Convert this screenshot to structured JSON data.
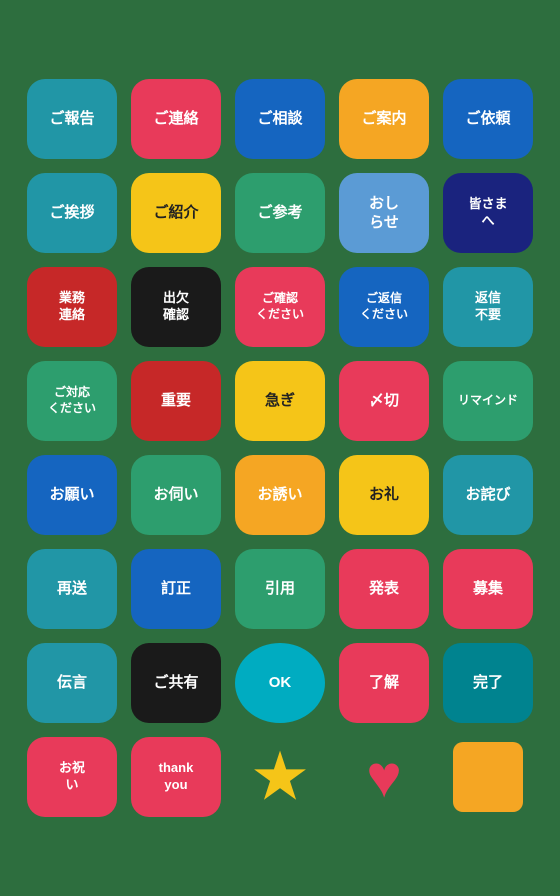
{
  "badges": [
    {
      "id": "gohoukoku",
      "label": "ご報告",
      "bg": "#2196a6",
      "textSize": "normal"
    },
    {
      "id": "gorenraku",
      "label": "ご連絡",
      "bg": "#e83a5a",
      "textSize": "normal"
    },
    {
      "id": "gosoudan",
      "label": "ご相談",
      "bg": "#1565c0",
      "textSize": "normal"
    },
    {
      "id": "goannai",
      "label": "ご案内",
      "bg": "#f5a623",
      "textSize": "normal"
    },
    {
      "id": "goirai",
      "label": "ご依頼",
      "bg": "#1565c0",
      "textSize": "normal"
    },
    {
      "id": "goaisatsu",
      "label": "ご挨拶",
      "bg": "#2196a6",
      "textSize": "normal"
    },
    {
      "id": "goshoukai",
      "label": "ご紹介",
      "bg": "#f5c518",
      "textSize": "normal",
      "textColor": "#222"
    },
    {
      "id": "gosankou",
      "label": "ご参考",
      "bg": "#2d9e6e",
      "textSize": "normal"
    },
    {
      "id": "oshirase",
      "label": "おし\nらせ",
      "bg": "#5b9bd5",
      "textSize": "normal"
    },
    {
      "id": "minasama",
      "label": "皆さま\nへ",
      "bg": "#1a237e",
      "textSize": "small"
    },
    {
      "id": "gyomuren",
      "label": "業務\n連絡",
      "bg": "#c62828",
      "textSize": "small"
    },
    {
      "id": "kesseki",
      "label": "出欠\n確認",
      "bg": "#1a1a1a",
      "textSize": "small"
    },
    {
      "id": "gokakunin",
      "label": "ご確認\nください",
      "bg": "#e83a5a",
      "textSize": "xsmall"
    },
    {
      "id": "gohensin",
      "label": "ご返信\nください",
      "bg": "#1565c0",
      "textSize": "xsmall"
    },
    {
      "id": "hensinfuyo",
      "label": "返信\n不要",
      "bg": "#2196a6",
      "textSize": "small"
    },
    {
      "id": "gotaio",
      "label": "ご対応\nください",
      "bg": "#2d9e6e",
      "textSize": "xsmall"
    },
    {
      "id": "juyo",
      "label": "重要",
      "bg": "#c62828",
      "textSize": "normal"
    },
    {
      "id": "isogi",
      "label": "急ぎ",
      "bg": "#f5c518",
      "textSize": "normal",
      "textColor": "#222"
    },
    {
      "id": "shimekiri",
      "label": "〆切",
      "bg": "#e83a5a",
      "textSize": "normal"
    },
    {
      "id": "rimaindo",
      "label": "リマインド",
      "bg": "#2d9e6e",
      "textSize": "xsmall"
    },
    {
      "id": "onegai",
      "label": "お願い",
      "bg": "#1565c0",
      "textSize": "normal"
    },
    {
      "id": "oukagai",
      "label": "お伺い",
      "bg": "#2d9e6e",
      "textSize": "normal"
    },
    {
      "id": "sasoi",
      "label": "お誘い",
      "bg": "#f5a623",
      "textSize": "normal"
    },
    {
      "id": "orei",
      "label": "お礼",
      "bg": "#f5c518",
      "textSize": "normal",
      "textColor": "#222"
    },
    {
      "id": "owabi",
      "label": "お詫び",
      "bg": "#2196a6",
      "textSize": "normal"
    },
    {
      "id": "saisou",
      "label": "再送",
      "bg": "#2196a6",
      "textSize": "normal"
    },
    {
      "id": "teisei",
      "label": "訂正",
      "bg": "#1565c0",
      "textSize": "normal"
    },
    {
      "id": "injou",
      "label": "引用",
      "bg": "#2d9e6e",
      "textSize": "normal"
    },
    {
      "id": "happyou",
      "label": "発表",
      "bg": "#e83a5a",
      "textSize": "normal"
    },
    {
      "id": "boshuu",
      "label": "募集",
      "bg": "#e83a5a",
      "textSize": "normal"
    },
    {
      "id": "dengon",
      "label": "伝言",
      "bg": "#2196a6",
      "textSize": "normal"
    },
    {
      "id": "gokyoyu",
      "label": "ご共有",
      "bg": "#1a1a1a",
      "textSize": "normal"
    },
    {
      "id": "ok",
      "label": "OK",
      "bg": "#00acc1",
      "textSize": "normal",
      "circle": true
    },
    {
      "id": "ryoukai",
      "label": "了解",
      "bg": "#e83a5a",
      "textSize": "normal"
    },
    {
      "id": "kanryo",
      "label": "完了",
      "bg": "#00838f",
      "textSize": "normal"
    },
    {
      "id": "oiwai",
      "label": "お祝\nい",
      "bg": "#e83a5a",
      "textSize": "small"
    },
    {
      "id": "thankyou",
      "label": "thank\nyou",
      "bg": "#e83a5a",
      "textSize": "normal",
      "thankyou": true
    },
    {
      "id": "star",
      "label": "★",
      "bg": null,
      "textSize": "star"
    },
    {
      "id": "heart",
      "label": "♥",
      "bg": null,
      "textSize": "heart"
    },
    {
      "id": "square",
      "label": "",
      "bg": null,
      "textSize": "square"
    }
  ],
  "bg": "#2d6e3e"
}
